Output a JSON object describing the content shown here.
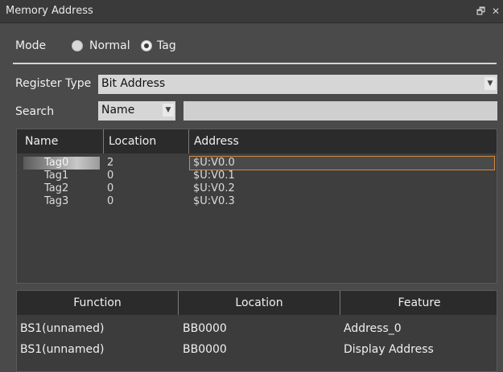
{
  "window": {
    "title": "Memory Address",
    "pin_icon": "pin-icon",
    "close_icon": "close-icon",
    "pin_glyph": "🗗",
    "close_glyph": "✕"
  },
  "mode": {
    "label": "Mode",
    "options": [
      {
        "label": "Normal",
        "selected": false
      },
      {
        "label": "Tag",
        "selected": true
      }
    ]
  },
  "register_type": {
    "label": "Register Type",
    "value": "Bit Address"
  },
  "search": {
    "label": "Search",
    "field_value": "Name",
    "text_value": ""
  },
  "tag_table": {
    "headers": [
      "Name",
      "Location",
      "Address"
    ],
    "rows": [
      {
        "name": "Tag0",
        "location": "2",
        "address": "$U:V0.0",
        "selected": true
      },
      {
        "name": "Tag1",
        "location": "0",
        "address": "$U:V0.1",
        "selected": false
      },
      {
        "name": "Tag2",
        "location": "0",
        "address": "$U:V0.2",
        "selected": false
      },
      {
        "name": "Tag3",
        "location": "0",
        "address": "$U:V0.3",
        "selected": false
      }
    ]
  },
  "function_table": {
    "headers": [
      "Function",
      "Location",
      "Feature"
    ],
    "rows": [
      {
        "function": "BS1(unnamed)",
        "location": "BB0000",
        "feature": "Address_0"
      },
      {
        "function": "BS1(unnamed)",
        "location": "BB0000",
        "feature": "Display Address"
      }
    ]
  },
  "colors": {
    "background": "#4a4a4a",
    "header": "#2b2b2b",
    "selection_border": "#d88a3a"
  }
}
